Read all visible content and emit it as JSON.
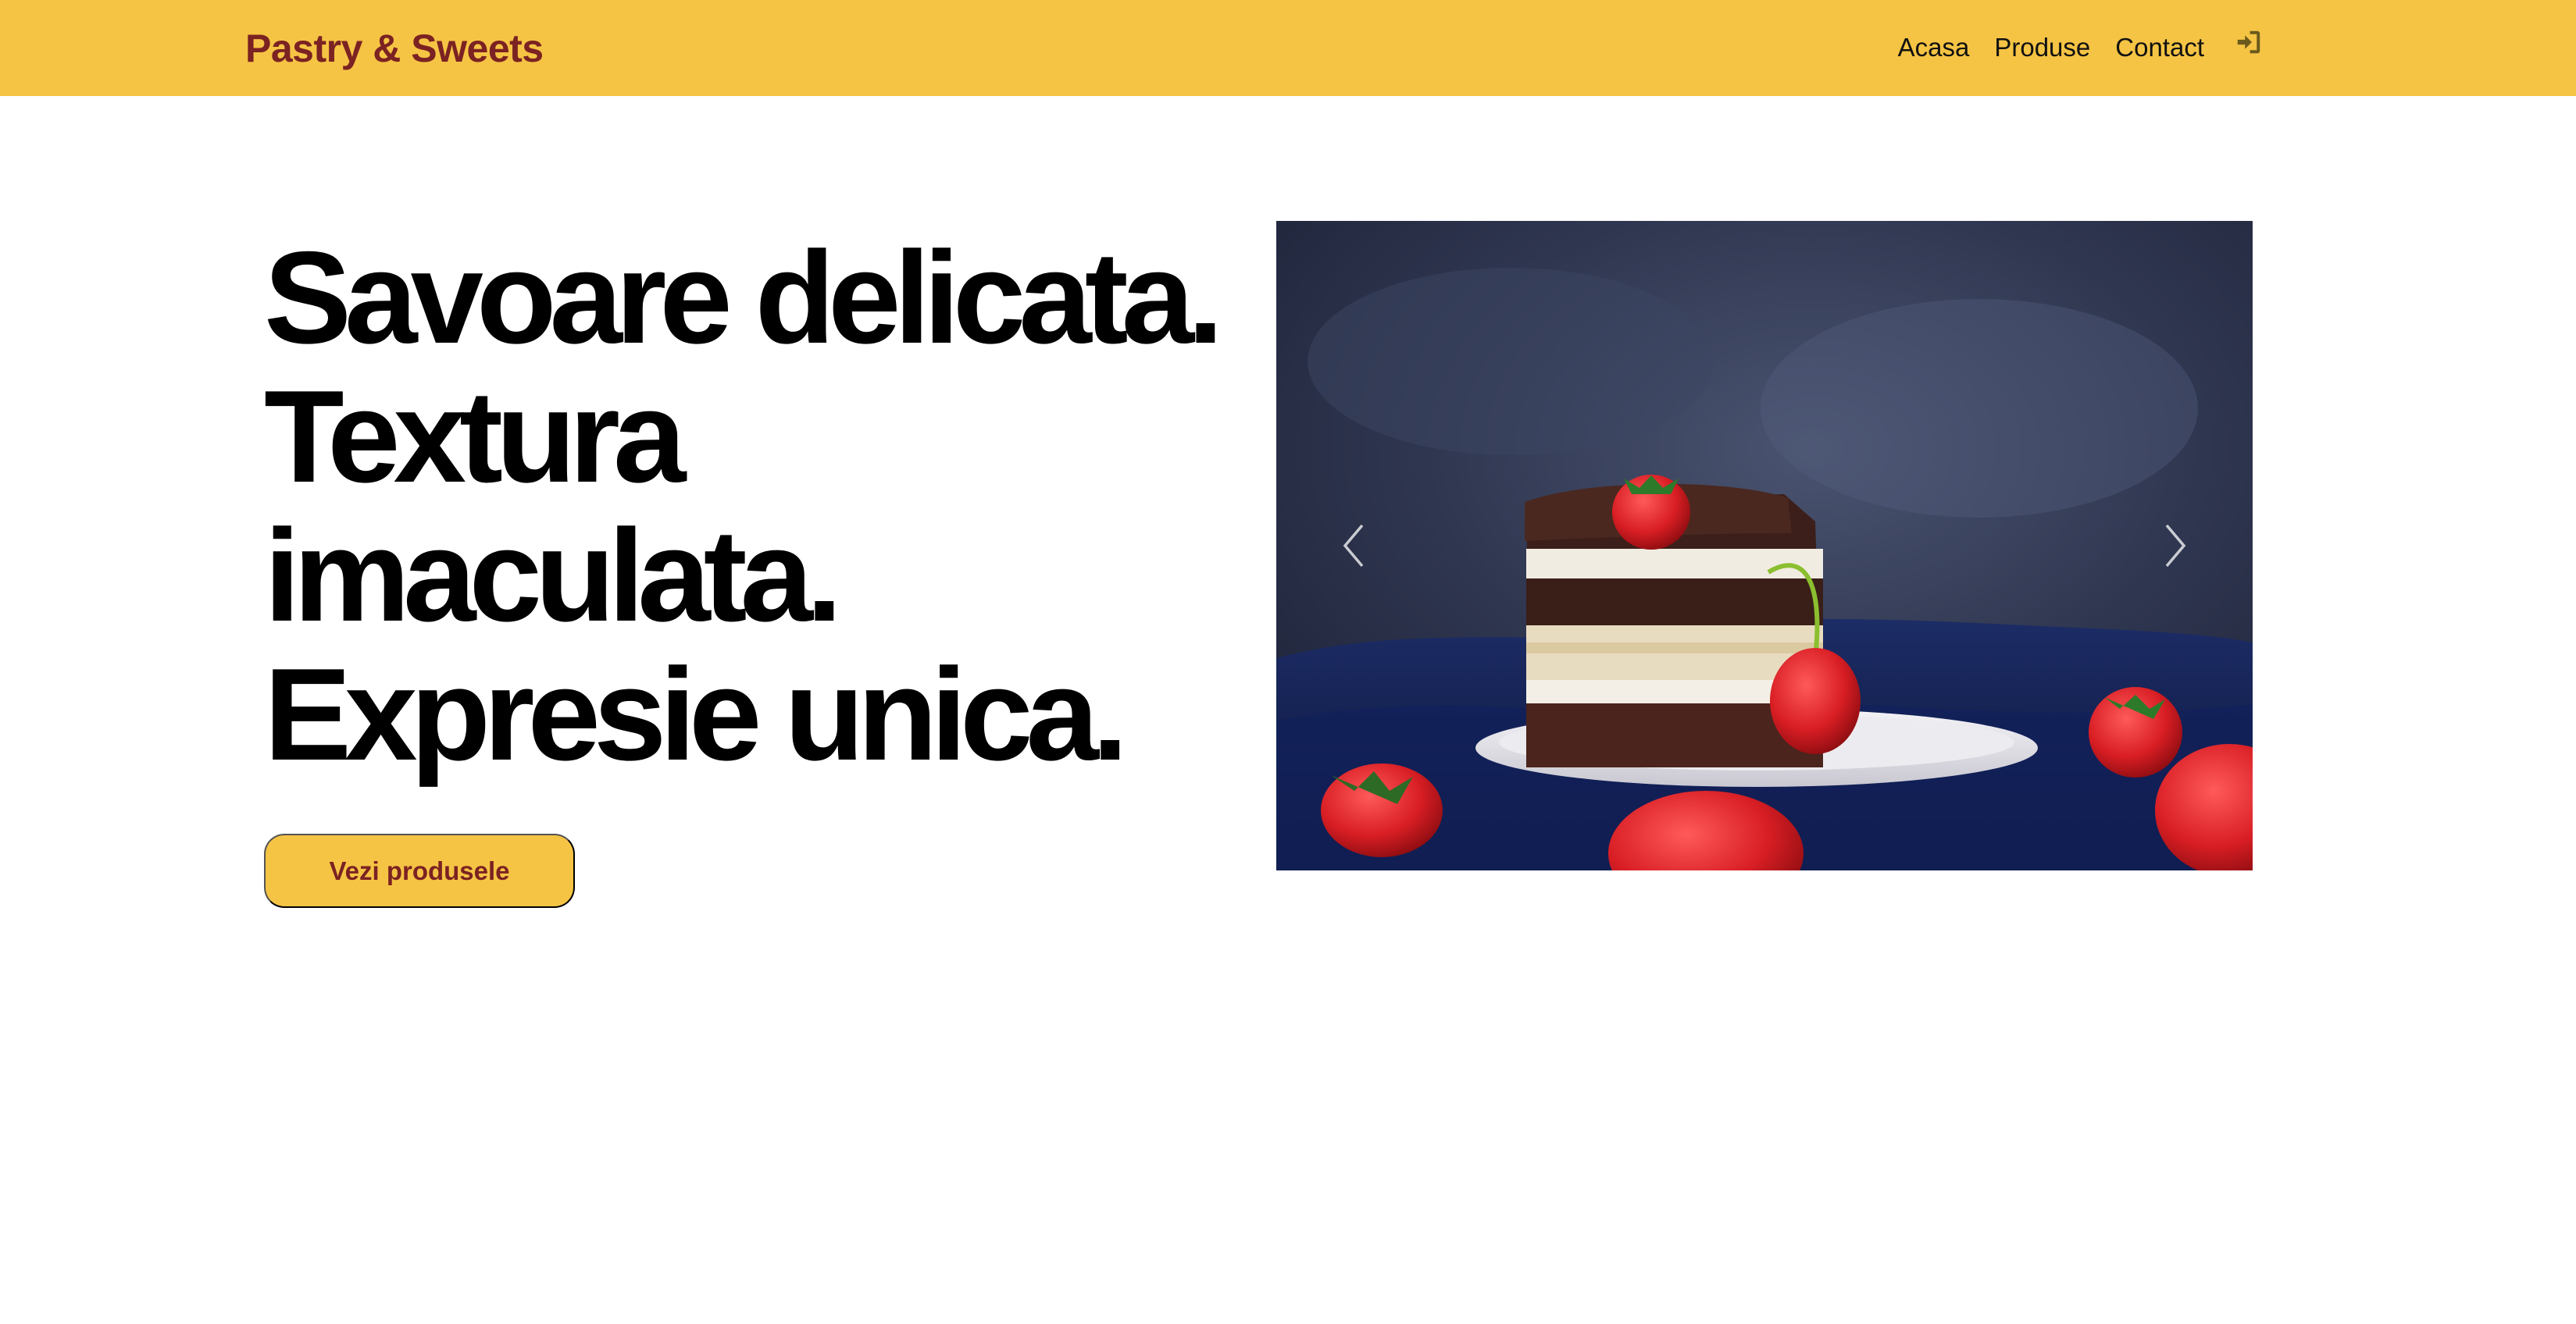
{
  "brand": "Pastry & Sweets",
  "nav": {
    "items": [
      {
        "label": "Acasa"
      },
      {
        "label": "Produse"
      },
      {
        "label": "Contact"
      }
    ],
    "login_icon": "login-icon"
  },
  "hero": {
    "headline_lines": [
      "Savoare delicata.",
      "Textura",
      "imaculata.",
      "Expresie unica."
    ],
    "cta_label": "Vezi produsele"
  },
  "carousel": {
    "image_subject": "cake-with-strawberries",
    "prev_icon": "chevron-left-icon",
    "next_icon": "chevron-right-icon"
  },
  "colors": {
    "accent": "#f5c444",
    "brand_text": "#7b2222",
    "headline": "#000000"
  }
}
